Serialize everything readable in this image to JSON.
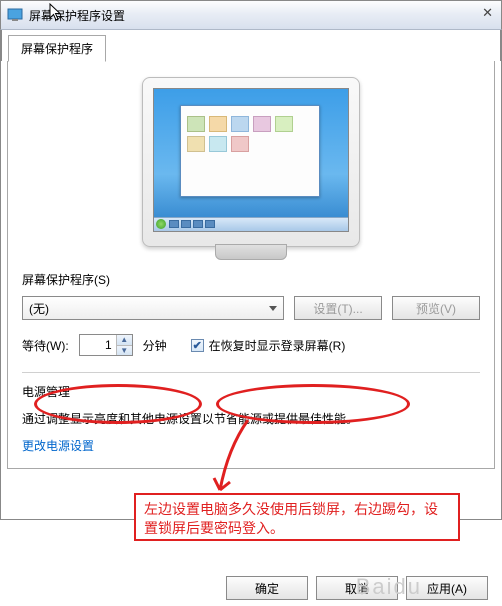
{
  "window": {
    "title": "屏幕保护程序设置"
  },
  "tab": {
    "label": "屏幕保护程序"
  },
  "section": {
    "saver_label": "屏幕保护程序(S)",
    "dropdown_value": "(无)",
    "settings_btn": "设置(T)...",
    "preview_btn": "预览(V)",
    "wait_label": "等待(W):",
    "wait_value": "1",
    "wait_unit": "分钟",
    "resume_label": "在恢复时显示登录屏幕(R)"
  },
  "power": {
    "heading": "电源管理",
    "text": "通过调整显示亮度和其他电源设置以节省能源或提供最佳性能。",
    "link": "更改电源设置"
  },
  "footer": {
    "ok": "确定",
    "cancel": "取消",
    "apply": "应用(A)"
  },
  "annotation": {
    "text": "左边设置电脑多久没使用后锁屏，右边踢勾，设置锁屏后要密码登入。"
  },
  "watermark": "Baidu"
}
